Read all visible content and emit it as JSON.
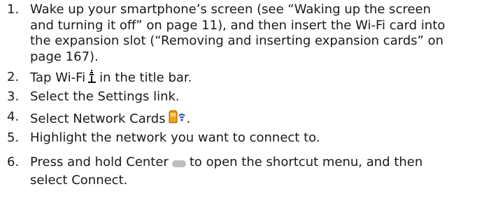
{
  "steps": [
    {
      "number": "1.",
      "lines": [
        "Wake up your smartphone’s screen (see “Waking up the screen",
        "and turning it off” on page 11), and then insert the Wi-Fi card into",
        "the expansion slot (“Removing and inserting expansion cards” on",
        "page 167)."
      ]
    },
    {
      "number": "2.",
      "before": "Tap Wi-Fi",
      "icon": "wifi-signal-icon",
      "after": "in the title bar."
    },
    {
      "number": "3.",
      "text": "Select the Settings link."
    },
    {
      "number": "4.",
      "before": "Select Network Cards",
      "icon": "network-cards-icon",
      "after": "."
    },
    {
      "number": "5.",
      "text": "Highlight the network you want to connect to."
    },
    {
      "number": "6.",
      "before": "Press and hold Center",
      "icon": "center-button-icon",
      "after": "to open the shortcut menu, and then",
      "line2": "select Connect."
    }
  ]
}
